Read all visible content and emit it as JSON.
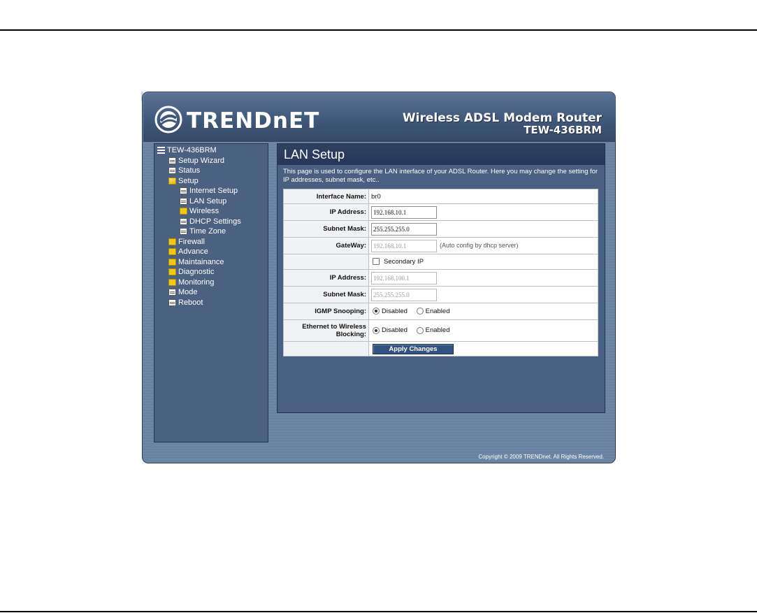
{
  "header": {
    "logo_text": "TRENDnET",
    "product_name": "Wireless ADSL Modem Router",
    "model_name": "TEW-436BRM"
  },
  "sidebar": {
    "root": "TEW-436BRM",
    "items": [
      {
        "label": "Setup Wizard",
        "icon": "document-icon"
      },
      {
        "label": "Status",
        "icon": "document-icon"
      },
      {
        "label": "Setup",
        "icon": "open-folder-icon"
      },
      {
        "label": "Internet Setup",
        "icon": "document-icon"
      },
      {
        "label": "LAN Setup",
        "icon": "document-icon"
      },
      {
        "label": "Wireless",
        "icon": "folder-icon"
      },
      {
        "label": "DHCP Settings",
        "icon": "document-icon"
      },
      {
        "label": "Time Zone",
        "icon": "document-icon"
      },
      {
        "label": "Firewall",
        "icon": "folder-icon"
      },
      {
        "label": "Advance",
        "icon": "folder-icon"
      },
      {
        "label": "Maintainance",
        "icon": "folder-icon"
      },
      {
        "label": "Diagnostic",
        "icon": "folder-icon"
      },
      {
        "label": "Monitoring",
        "icon": "folder-icon"
      },
      {
        "label": "Mode",
        "icon": "document-icon"
      },
      {
        "label": "Reboot",
        "icon": "document-icon"
      }
    ]
  },
  "main": {
    "title": "LAN Setup",
    "description": "This page is used to configure the LAN interface of your ADSL Router. Here you may change the setting for IP addresses, subnet mask, etc..",
    "interface_name": {
      "label": "Interface Name:",
      "value": "br0"
    },
    "ip_address": {
      "label": "IP Address:",
      "value": "192.168.10.1"
    },
    "subnet_mask": {
      "label": "Subnet Mask:",
      "value": "255.255.255.0"
    },
    "gateway": {
      "label": "GateWay:",
      "value": "192.168.10.1",
      "hint": "(Auto config by dhcp server)"
    },
    "secondary_ip": {
      "label": "Secondary IP",
      "checked": false
    },
    "secondary_ip_address": {
      "label": "IP Address:",
      "value": "192.168.100.1"
    },
    "secondary_subnet_mask": {
      "label": "Subnet Mask:",
      "value": "255.255.255.0"
    },
    "igmp_snooping": {
      "label": "IGMP Snooping:",
      "disabled_label": "Disabled",
      "enabled_label": "Enabled",
      "selected": "Disabled"
    },
    "eth_wireless_blocking": {
      "label": "Ethernet to Wireless Blocking:",
      "disabled_label": "Disabled",
      "enabled_label": "Enabled",
      "selected": "Disabled"
    },
    "apply_label": "Apply Changes"
  },
  "footer": {
    "copyright": "Copyright © 2009 TRENDnet. All Rights Reserved."
  },
  "colors": {
    "frame": "#6f87a6",
    "panel": "#4a6082",
    "title_bar": "#2e4262",
    "button": "#32527f"
  }
}
